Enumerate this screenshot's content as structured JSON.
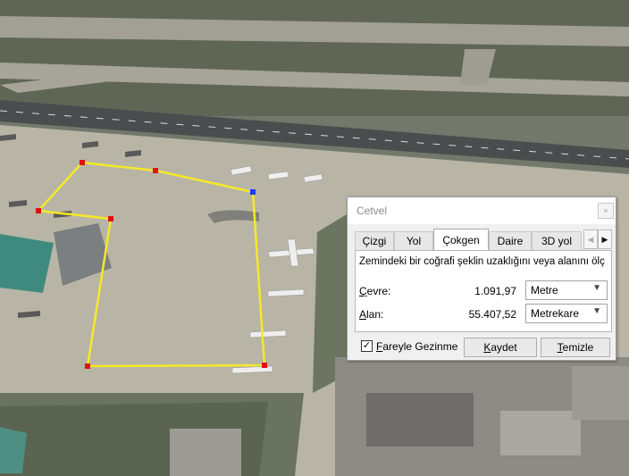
{
  "dialog": {
    "title": "Cetvel",
    "close_glyph": "×",
    "tabs": [
      "Çizgi",
      "Yol",
      "Çokgen",
      "Daire",
      "3D yol"
    ],
    "active_tab": "Çokgen",
    "tab_prev": "◀",
    "tab_next": "▶",
    "description": "Zemindeki bir coğrafi şeklin uzaklığını veya alanını ölç",
    "perimeter": {
      "label": "Çevre:",
      "value": "1.091,97",
      "unit": "Metre"
    },
    "area": {
      "label": "Alan:",
      "value": "55.407,52",
      "unit": "Metrekare"
    },
    "mouse_nav": {
      "label": "Fareyle Gezinme",
      "checked": true
    },
    "save_label": "Kaydet",
    "clear_label": "Temizle",
    "dropdown_glyph": "▼"
  },
  "colors": {
    "polygon_line": "#f5e928",
    "vertex": "#e01010",
    "active_vertex": "#1a3cff",
    "apron": "#b9b6a5",
    "grass": "#5e6651"
  }
}
